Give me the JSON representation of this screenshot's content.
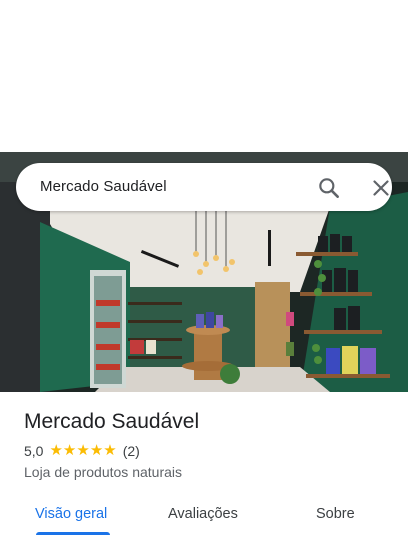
{
  "search": {
    "query": "Mercado Saudável"
  },
  "icons": {
    "search": "search-icon",
    "close": "close-icon",
    "star": "star-icon"
  },
  "place": {
    "name": "Mercado Saudável",
    "rating": "5,0",
    "stars": 5,
    "review_count": "(2)",
    "category": "Loja de produtos naturais"
  },
  "tabs": [
    {
      "label": "Visão geral",
      "active": true
    },
    {
      "label": "Avaliações",
      "active": false
    },
    {
      "label": "Sobre",
      "active": false
    }
  ],
  "colors": {
    "accent": "#1a73e8",
    "star": "#fbbc04",
    "wall_green": "#1f6a4f"
  }
}
